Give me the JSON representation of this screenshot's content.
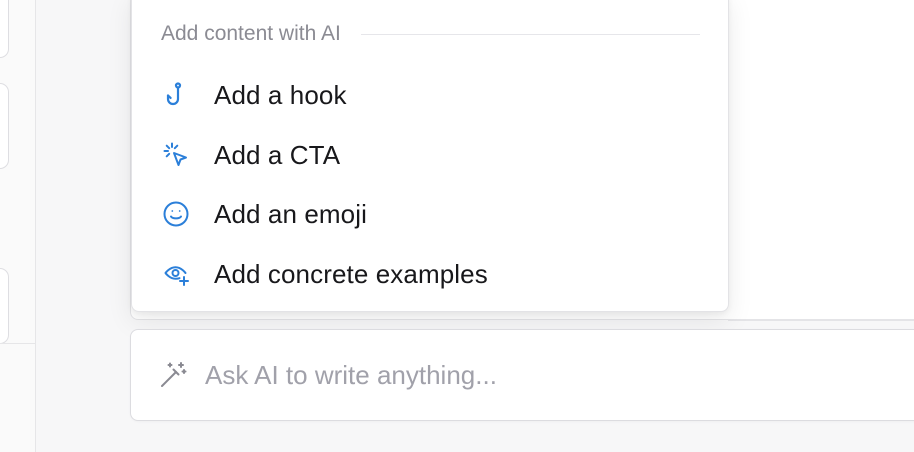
{
  "colors": {
    "accent": "#2b7fd9",
    "muted_text": "#8b8b93",
    "text": "#18181b",
    "placeholder": "#a1a1aa"
  },
  "menu": {
    "section_title": "Add content with AI",
    "items": [
      {
        "label": "Add a hook",
        "icon": "hook-icon"
      },
      {
        "label": "Add a CTA",
        "icon": "pointer-click-icon"
      },
      {
        "label": "Add an emoji",
        "icon": "smile-icon"
      },
      {
        "label": "Add concrete examples",
        "icon": "eye-plus-icon"
      }
    ]
  },
  "ask_ai": {
    "icon": "magic-wand-icon",
    "placeholder": "Ask AI to write anything..."
  }
}
